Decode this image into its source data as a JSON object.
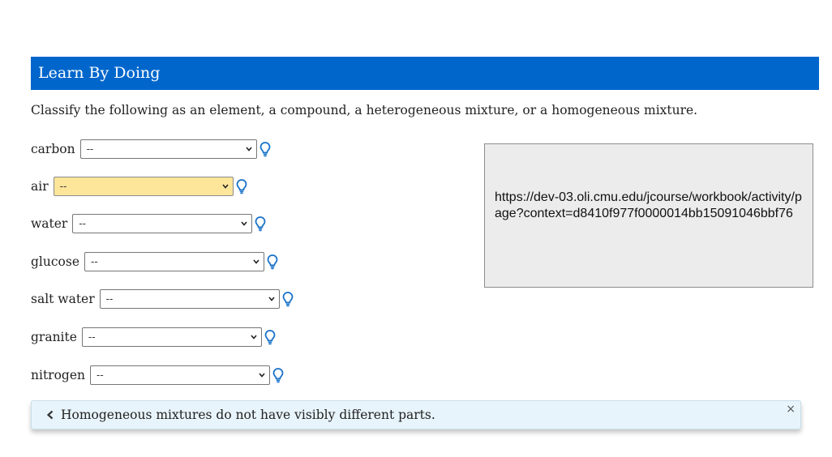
{
  "header": {
    "title": "Learn By Doing"
  },
  "instructions": "Classify the following as an element, a compound, a heterogeneous mixture, or a homogeneous mixture.",
  "items": [
    {
      "label": "carbon",
      "selected": "--"
    },
    {
      "label": "air",
      "selected": "--"
    },
    {
      "label": "water",
      "selected": "--"
    },
    {
      "label": "glucose",
      "selected": "--"
    },
    {
      "label": "salt water",
      "selected": "--"
    },
    {
      "label": "granite",
      "selected": "--"
    },
    {
      "label": "nitrogen",
      "selected": "--"
    }
  ],
  "url_box": {
    "text": "https://dev-03.oli.cmu.edu/jcourse/workbook/activity/page?context=d8410f977f0000014bb15091046bbf76"
  },
  "feedback": {
    "text": "Homogeneous mixtures do not have visibly different parts.",
    "close_label": "×"
  },
  "colors": {
    "header_bg": "#0066cc",
    "highlight_select": "#fde69a",
    "hint_icon": "#1a73c9",
    "feedback_bg": "#e8f4fb"
  },
  "icons": {
    "hint": "lightbulb-icon",
    "dropdown": "chevron-down-icon",
    "back": "chevron-left-icon",
    "close": "close-icon"
  }
}
